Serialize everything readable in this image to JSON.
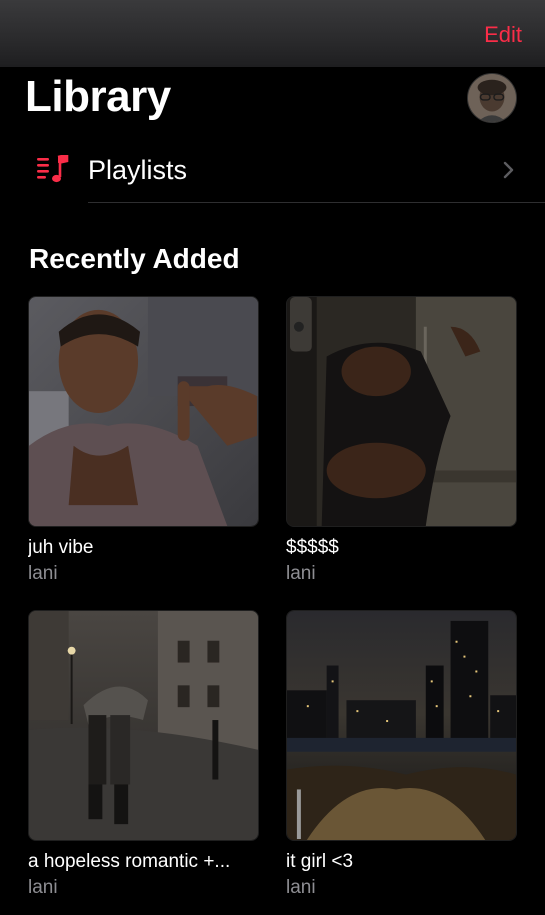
{
  "header": {
    "edit_label": "Edit",
    "title": "Library"
  },
  "accent_color": "#fa2d48",
  "nav": {
    "playlists_label": "Playlists",
    "playlists_icon": "playlist-music-icon",
    "chevron_icon": "chevron-right-icon"
  },
  "recently_added": {
    "title": "Recently Added",
    "albums": [
      {
        "title": "juh vibe",
        "artist": "lani"
      },
      {
        "title": "$$$$$",
        "artist": "lani"
      },
      {
        "title": "a hopeless romantic +...",
        "artist": "lani"
      },
      {
        "title": "it girl <3",
        "artist": "lani"
      }
    ]
  }
}
